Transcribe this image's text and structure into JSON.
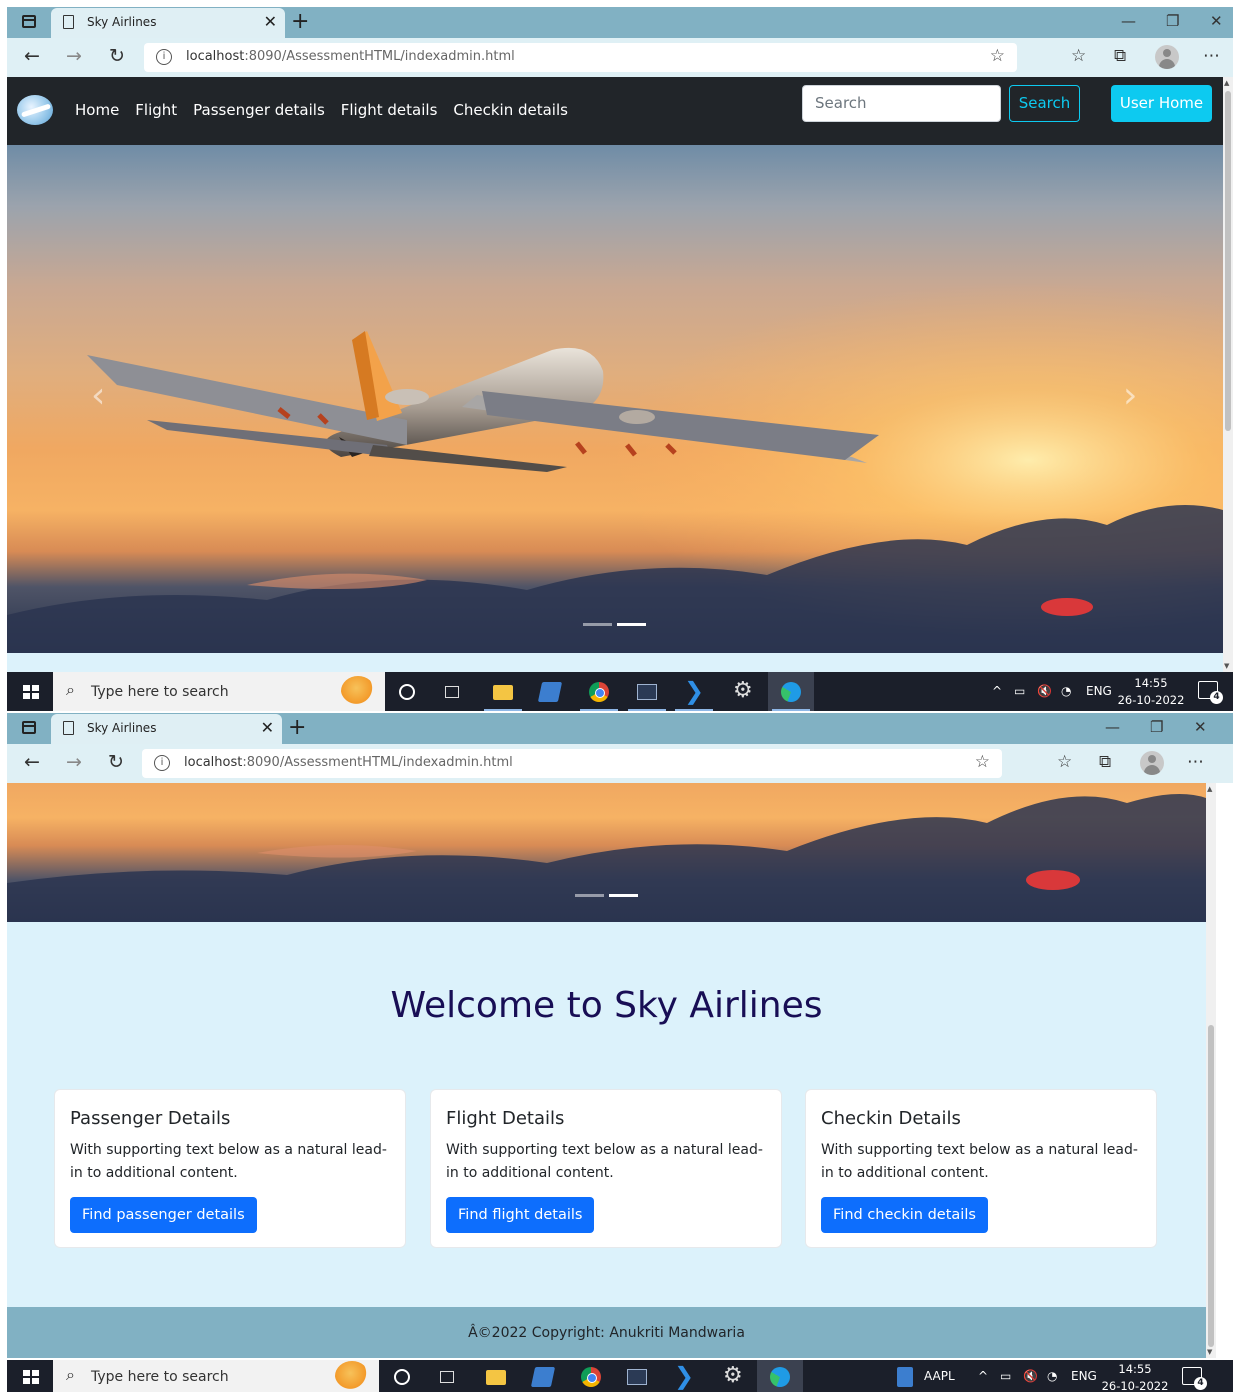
{
  "browser": {
    "tab_title": "Sky Airlines",
    "url_host": "localhost",
    "url_rest": ":8090/AssessmentHTML/indexadmin.html"
  },
  "site": {
    "nav_links": [
      "Home",
      "Flight",
      "Passenger details",
      "Flight details",
      "Checkin details"
    ],
    "search_placeholder": "Search",
    "search_button": "Search",
    "user_home_button": "User Home",
    "welcome_title": "Welcome to Sky Airlines",
    "cards": [
      {
        "title": "Passenger Details",
        "text": "With supporting text below as a natural lead-in to additional content.",
        "button": "Find passenger details"
      },
      {
        "title": "Flight Details",
        "text": "With supporting text below as a natural lead-in to additional content.",
        "button": "Find flight details"
      },
      {
        "title": "Checkin Details",
        "text": "With supporting text below as a natural lead-in to additional content.",
        "button": "Find checkin details"
      }
    ],
    "footer_text": "Â©2022 Copyright: Anukriti Mandwaria",
    "carousel": {
      "slides": 2,
      "active_slide": 2
    }
  },
  "taskbar": {
    "search_text": "Type here to search",
    "tray_lang": "ENG",
    "clock_time": "14:55",
    "clock_date": "26-10-2022",
    "notification_count": "4",
    "aapl_label": "AAPL"
  },
  "colors": {
    "navbar_bg": "#212529",
    "page_bg": "#dcf2fb",
    "tab_strip": "#81b1c3",
    "cyan_button": "#0dcaf0",
    "primary_button": "#0d6efd",
    "welcome_text": "#180e55"
  }
}
